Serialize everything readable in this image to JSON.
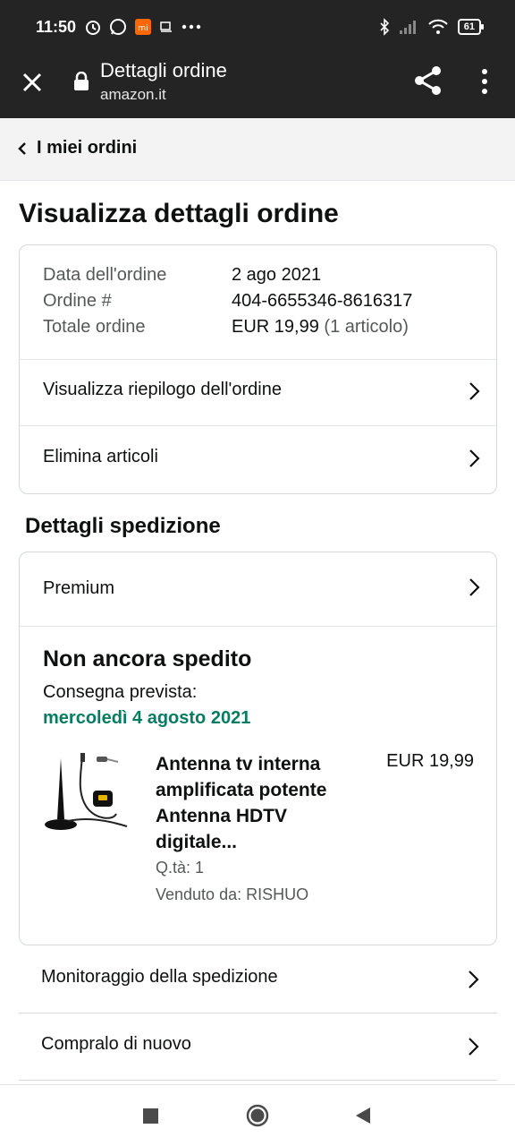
{
  "status_bar": {
    "time": "11:50",
    "battery": "61",
    "icons_left": [
      "alarm-icon",
      "whatsapp-icon",
      "mi-app-icon",
      "notification-icon",
      "more-notifications-icon"
    ],
    "icons_right": [
      "bluetooth-icon",
      "signal-icon",
      "wifi-icon",
      "battery-icon"
    ]
  },
  "toolbar": {
    "title": "Dettagli ordine",
    "url": "amazon.it",
    "icons": [
      "close-icon",
      "lock-icon",
      "share-icon",
      "more-vert-icon"
    ]
  },
  "breadcrumb": {
    "label": "I miei ordini"
  },
  "page": {
    "title": "Visualizza dettagli ordine"
  },
  "order_summary": {
    "date_label": "Data dell'ordine",
    "date_value": "2 ago 2021",
    "number_label": "Ordine #",
    "number_value": "404-6655346-8616317",
    "total_label": "Totale ordine",
    "total_value": "EUR 19,99",
    "total_items": "(1 articolo)",
    "actions": [
      {
        "label": "Visualizza riepilogo dell'ordine"
      },
      {
        "label": "Elimina articoli"
      }
    ]
  },
  "shipping": {
    "section_title": "Dettagli spedizione",
    "method": "Premium",
    "status": "Non ancora spedito",
    "delivery_label": "Consegna prevista:",
    "delivery_date": "mercoledì 4 agosto 2021",
    "delivery_color": "#067d62",
    "product": {
      "title": "Antenna tv interna amplificata potente Antenna HDTV digitale...",
      "price": "EUR 19,99",
      "qty": "Q.tà: 1",
      "seller": "Venduto da: RISHUO"
    }
  },
  "more_actions": [
    {
      "label": "Monitoraggio della spedizione"
    },
    {
      "label": "Compralo di nuovo"
    }
  ],
  "nav": {
    "icons": [
      "recents-icon",
      "home-icon",
      "back-icon"
    ]
  }
}
